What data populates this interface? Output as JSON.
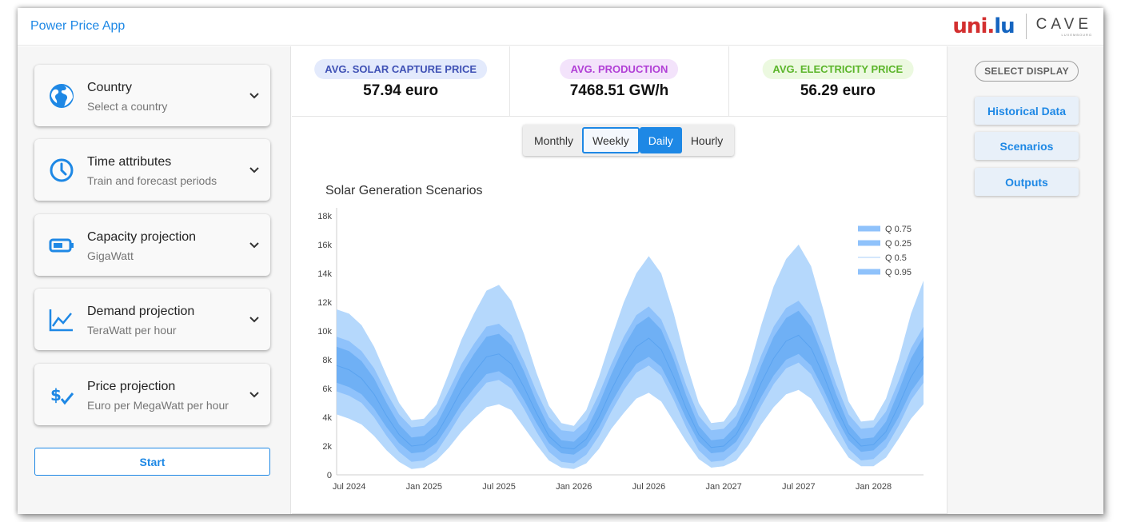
{
  "app": {
    "title": "Power Price App"
  },
  "logos": {
    "unilu_a": "uni.",
    "unilu_b": "lu",
    "cave": "CAVE",
    "cave_sub": "LUXEMBOURG"
  },
  "sidebar": {
    "cards": [
      {
        "title": "Country",
        "subtitle": "Select a country",
        "icon": "globe-icon"
      },
      {
        "title": "Time attributes",
        "subtitle": "Train and forecast periods",
        "icon": "clock-icon"
      },
      {
        "title": "Capacity projection",
        "subtitle": "GigaWatt",
        "icon": "battery-icon"
      },
      {
        "title": "Demand projection",
        "subtitle": "TeraWatt per hour",
        "icon": "trend-chart-icon"
      },
      {
        "title": "Price projection",
        "subtitle": "Euro per MegaWatt per hour",
        "icon": "dollar-check-icon"
      }
    ],
    "start_label": "Start"
  },
  "kpis": [
    {
      "label": "AVG. SOLAR CAPTURE PRICE",
      "value": "57.94 euro",
      "color": "#3f51b5"
    },
    {
      "label": "AVG. PRODUCTION",
      "value": "7468.51 GW/h",
      "color": "#b13fd6"
    },
    {
      "label": "AVG. ELECTRICITY PRICE",
      "value": "56.29 euro",
      "color": "#5bb52a"
    }
  ],
  "granularity": {
    "options": [
      "Monthly",
      "Weekly",
      "Daily",
      "Hourly"
    ],
    "selected": "Daily",
    "focused": "Weekly"
  },
  "right_panel": {
    "header": "SELECT DISPLAY",
    "buttons": [
      "Historical Data",
      "Scenarios",
      "Outputs"
    ]
  },
  "chart_data": {
    "type": "area",
    "title": "Solar Generation Scenarios",
    "x_ticks": [
      "Jul 2024",
      "Jan 2025",
      "Jul 2025",
      "Jan 2026",
      "Jul 2026",
      "Jan 2027",
      "Jul 2027",
      "Jan 2028"
    ],
    "y_ticks": [
      "0",
      "2k",
      "4k",
      "6k",
      "8k",
      "10k",
      "12k",
      "14k",
      "16k",
      "18k"
    ],
    "ylim": [
      0,
      18000
    ],
    "legend_position": "top-right",
    "series": [
      {
        "name": "Q 0.75",
        "color": "#8fc2fb"
      },
      {
        "name": "Q 0.25",
        "color": "#8fc2fb"
      },
      {
        "name": "Q 0.5",
        "color": "#a9cff8"
      },
      {
        "name": "Q 0.95",
        "color": "#8fc2fb"
      }
    ],
    "x": [
      "2024-06",
      "2024-07",
      "2024-08",
      "2024-09",
      "2024-10",
      "2024-11",
      "2024-12",
      "2025-01",
      "2025-02",
      "2025-03",
      "2025-04",
      "2025-05",
      "2025-06",
      "2025-07",
      "2025-08",
      "2025-09",
      "2025-10",
      "2025-11",
      "2025-12",
      "2026-01",
      "2026-02",
      "2026-03",
      "2026-04",
      "2026-05",
      "2026-06",
      "2026-07",
      "2026-08",
      "2026-09",
      "2026-10",
      "2026-11",
      "2026-12",
      "2027-01",
      "2027-02",
      "2027-03",
      "2027-04",
      "2027-05",
      "2027-06",
      "2027-07",
      "2027-08",
      "2027-09",
      "2027-10",
      "2027-11",
      "2027-12",
      "2028-01",
      "2028-02",
      "2028-03",
      "2028-04",
      "2028-05"
    ],
    "bands": {
      "q05": [
        4500,
        4200,
        3800,
        3000,
        2000,
        1200,
        700,
        800,
        1300,
        2200,
        3300,
        4200,
        5000,
        5200,
        4800,
        3600,
        2400,
        1300,
        800,
        700,
        1100,
        2100,
        3500,
        4600,
        5600,
        6000,
        5400,
        4000,
        2600,
        1400,
        800,
        900,
        1300,
        2400,
        3800,
        5000,
        5900,
        6200,
        5600,
        4200,
        2800,
        1500,
        900,
        900,
        1500,
        2800,
        4200,
        5200
      ],
      "q25": [
        6400,
        6100,
        5600,
        4600,
        3300,
        2200,
        1500,
        1600,
        2200,
        3500,
        4900,
        6000,
        7000,
        7200,
        6600,
        5200,
        3600,
        2200,
        1500,
        1400,
        2000,
        3300,
        5000,
        6500,
        7700,
        8200,
        7500,
        5800,
        3900,
        2300,
        1500,
        1600,
        2300,
        3700,
        5400,
        6900,
        8000,
        8400,
        7600,
        5900,
        4000,
        2400,
        1600,
        1700,
        2500,
        4000,
        5800,
        7000
      ],
      "q50": [
        7600,
        7300,
        6700,
        5600,
        4100,
        2800,
        2000,
        2100,
        2800,
        4300,
        5900,
        7100,
        8200,
        8400,
        7700,
        6100,
        4300,
        2700,
        1900,
        1800,
        2500,
        4000,
        5900,
        7600,
        8900,
        9500,
        8700,
        6800,
        4600,
        2800,
        1900,
        2000,
        2800,
        4400,
        6400,
        8100,
        9300,
        9700,
        8800,
        6900,
        4700,
        2900,
        2000,
        2100,
        3000,
        4800,
        6800,
        8200
      ],
      "q75": [
        8900,
        8600,
        7900,
        6700,
        5000,
        3500,
        2600,
        2700,
        3500,
        5200,
        7000,
        8400,
        9600,
        9800,
        9000,
        7200,
        5100,
        3300,
        2400,
        2300,
        3100,
        4900,
        7000,
        8900,
        10400,
        11000,
        10100,
        8000,
        5500,
        3400,
        2400,
        2500,
        3400,
        5300,
        7600,
        9600,
        10900,
        11400,
        10300,
        8100,
        5600,
        3500,
        2500,
        2600,
        3700,
        5800,
        8100,
        9600
      ],
      "q95": [
        11500,
        11200,
        10400,
        8900,
        6900,
        5000,
        3800,
        3900,
        4900,
        7100,
        9400,
        11200,
        12800,
        13200,
        12100,
        9800,
        7100,
        4800,
        3600,
        3400,
        4500,
        6800,
        9500,
        12000,
        14000,
        15200,
        14000,
        11200,
        7800,
        5000,
        3600,
        3700,
        4900,
        7300,
        10400,
        13100,
        15000,
        16000,
        14500,
        11400,
        8000,
        5100,
        3700,
        3800,
        5300,
        8000,
        11200,
        13500
      ]
    }
  }
}
